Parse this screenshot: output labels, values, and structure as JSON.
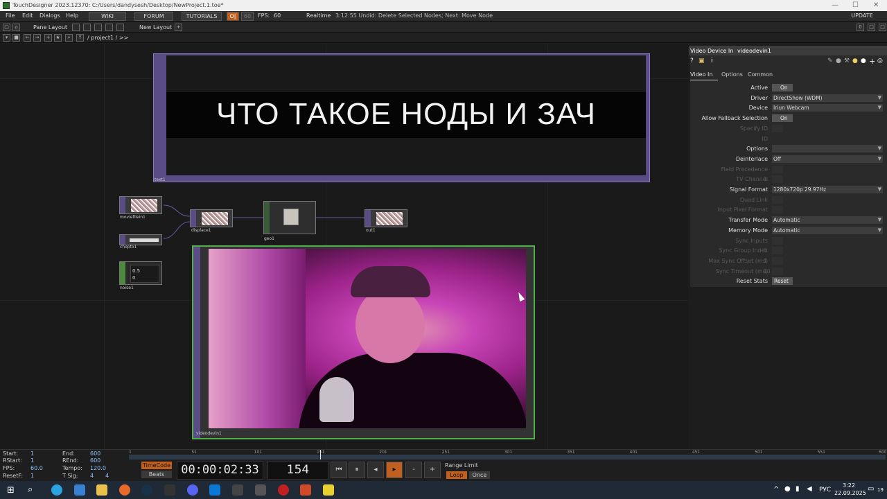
{
  "window": {
    "title": "TouchDesigner 2023.12370: C:/Users/dandysesh/Desktop/NewProject.1.toe*"
  },
  "menu": {
    "file": "File",
    "edit": "Edit",
    "dialogs": "Dialogs",
    "help": "Help",
    "wiki": "WIKI",
    "forum": "FORUM",
    "tutorials": "TUTORIALS",
    "fps_label": "FPS:",
    "fps_value": "60",
    "fps_target": "60",
    "realtime": "Realtime",
    "status": "3:12:55 Undid: Delete Selected Nodes; Next: Move Node",
    "update": "UPDATE"
  },
  "panebar": {
    "pane_layout": "Pane Layout",
    "new_layout": "New Layout"
  },
  "path": {
    "path": "/ project1 / >>"
  },
  "network": {
    "text_node": "text1",
    "text_content": "ЧТО ТАКОЕ НОДЫ И ЗАЧ",
    "nodes": [
      "moviefilein1",
      "displace1",
      "geo1",
      "out1",
      "chopto1",
      "noise1"
    ],
    "noise_values": [
      "0.5",
      "0"
    ],
    "video_node": "videodevin1"
  },
  "params": {
    "op_type": "Video Device In",
    "op_name": "videodevin1",
    "tabs": [
      "Video In",
      "Options",
      "Common"
    ],
    "rows": [
      {
        "label": "Active",
        "value": "On",
        "kind": "toggle"
      },
      {
        "label": "Driver",
        "value": "DirectShow (WDM)",
        "kind": "menu"
      },
      {
        "label": "Device",
        "value": "Iriun Webcam",
        "kind": "menu"
      },
      {
        "label": "Allow Fallback Selection",
        "value": "On",
        "kind": "toggle"
      },
      {
        "label": "Specify ID",
        "value": "",
        "kind": "dim"
      },
      {
        "label": "ID",
        "value": "",
        "kind": "dimlabel"
      },
      {
        "label": "Options",
        "value": "",
        "kind": "menu"
      },
      {
        "label": "Deinterlace",
        "value": "Off",
        "kind": "menu"
      },
      {
        "label": "Field Precedence",
        "value": "",
        "kind": "dim"
      },
      {
        "label": "TV Channel",
        "value": "1",
        "kind": "dim"
      },
      {
        "label": "Signal Format",
        "value": "1280x720p 29.97Hz",
        "kind": "menu"
      },
      {
        "label": "Quad Link",
        "value": "",
        "kind": "dim"
      },
      {
        "label": "Input Pixel Format",
        "value": "",
        "kind": "dim"
      },
      {
        "label": "Transfer Mode",
        "value": "Automatic",
        "kind": "menu"
      },
      {
        "label": "Memory Mode",
        "value": "Automatic",
        "kind": "menu"
      },
      {
        "label": "Sync Inputs",
        "value": "",
        "kind": "dim"
      },
      {
        "label": "Sync Group Index",
        "value": "0",
        "kind": "dim"
      },
      {
        "label": "Max Sync Offset (ms)",
        "value": "1",
        "kind": "dim"
      },
      {
        "label": "Sync Timeout (ms)",
        "value": "10",
        "kind": "dim"
      },
      {
        "label": "Reset Stats",
        "value": "Reset",
        "kind": "button"
      }
    ]
  },
  "timeline": {
    "start_label": "Start:",
    "start": "1",
    "rstart_label": "RStart:",
    "rstart": "1",
    "fps_label": "FPS:",
    "fps": "60.0",
    "resetf_label": "ResetF:",
    "resetf": "1",
    "end_label": "End:",
    "end": "600",
    "rend_label": "REnd:",
    "rend": "600",
    "tempo_label": "Tempo:",
    "tempo": "120.0",
    "tsig_label": "T Sig:",
    "tsig_a": "4",
    "tsig_b": "4",
    "timecode_btn": "TimeCode",
    "beats_btn": "Beats",
    "timecode": "00:00:02:33",
    "frame": "154",
    "range_limit": "Range Limit",
    "loop": "Loop",
    "once": "Once",
    "ticks": [
      "1",
      "51",
      "101",
      "151",
      "201",
      "251",
      "301",
      "351",
      "401",
      "451",
      "501",
      "551",
      "600"
    ],
    "playhead_frame": 154
  },
  "taskbar": {
    "lang": "РУС",
    "time": "3:22",
    "date": "22.09.2025",
    "notif_count": "19"
  }
}
